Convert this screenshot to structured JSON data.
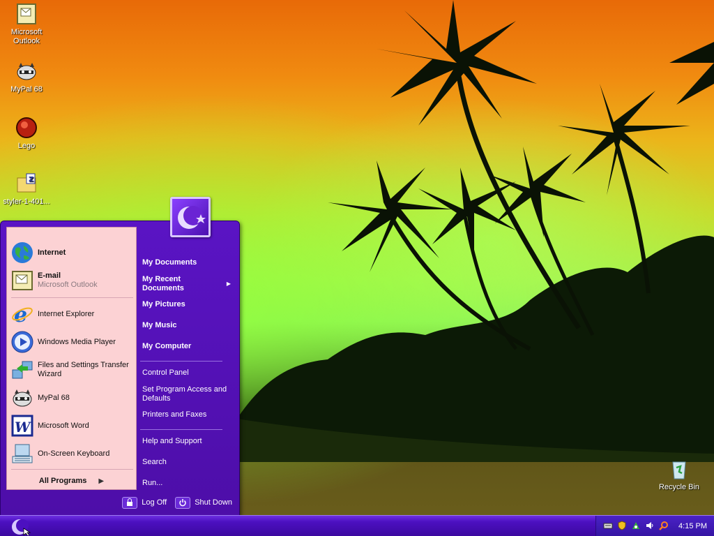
{
  "desktop": {
    "icons": [
      {
        "label": "Microsoft Outlook",
        "icon": "outlook-icon"
      },
      {
        "label": "MyPal 68",
        "icon": "raccoon-icon"
      },
      {
        "label": "Lego",
        "icon": "lego-icon"
      },
      {
        "label": "styler-1-401...",
        "icon": "zip-folder-icon"
      },
      {
        "label": "Recycle Bin",
        "icon": "recycle-bin-icon"
      }
    ]
  },
  "start_menu": {
    "pinned": [
      {
        "label": "Internet",
        "icon": "globe-icon"
      },
      {
        "label": "E-mail",
        "sublabel": "Microsoft Outlook",
        "icon": "outlook-icon"
      }
    ],
    "recent": [
      {
        "label": "Internet Explorer",
        "icon": "internet-explorer-icon"
      },
      {
        "label": "Windows Media Player",
        "icon": "media-player-icon"
      },
      {
        "label": "Files and Settings Transfer Wizard",
        "icon": "transfer-wizard-icon"
      },
      {
        "label": "MyPal 68",
        "icon": "raccoon-icon"
      },
      {
        "label": "Microsoft Word",
        "icon": "word-icon"
      },
      {
        "label": "On-Screen Keyboard",
        "icon": "keyboard-icon"
      }
    ],
    "all_programs": "All Programs",
    "places": [
      {
        "label": "My Documents"
      },
      {
        "label": "My Recent Documents"
      },
      {
        "label": "My Pictures"
      },
      {
        "label": "My Music"
      },
      {
        "label": "My Computer"
      }
    ],
    "system": [
      {
        "label": "Control Panel"
      },
      {
        "label": "Set Program Access and Defaults"
      },
      {
        "label": "Printers and Faxes"
      }
    ],
    "help": [
      {
        "label": "Help and Support"
      },
      {
        "label": "Search"
      },
      {
        "label": "Run..."
      }
    ],
    "log_off": "Log Off",
    "shut_down": "Shut Down"
  },
  "taskbar": {
    "clock": "4:15 PM",
    "tray_icons": [
      "keyboard-icon",
      "shield-icon",
      "network-icon",
      "speaker-icon",
      "search-icon"
    ]
  },
  "colors": {
    "menu_purple": "#5a14c4",
    "left_pane": "#fcd2d4",
    "taskbar": "#4c10c0"
  }
}
